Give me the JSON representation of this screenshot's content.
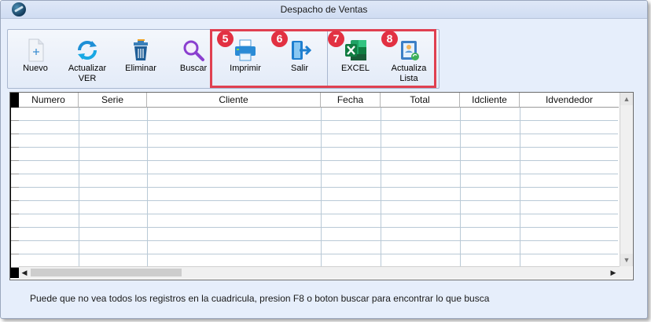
{
  "window": {
    "title": "Despacho de Ventas"
  },
  "toolbar": {
    "buttons": [
      {
        "label_1": "Nuevo",
        "label_2": "",
        "icon": "new-document-icon"
      },
      {
        "label_1": "Actualizar",
        "label_2": "VER",
        "icon": "refresh-icon"
      },
      {
        "label_1": "Eliminar",
        "label_2": "",
        "icon": "trash-icon"
      },
      {
        "label_1": "Buscar",
        "label_2": "",
        "icon": "search-icon"
      },
      {
        "label_1": "Imprimir",
        "label_2": "",
        "icon": "printer-icon",
        "badge": "5"
      },
      {
        "label_1": "Salir",
        "label_2": "",
        "icon": "exit-icon",
        "badge": "6"
      },
      {
        "label_1": "EXCEL",
        "label_2": "",
        "icon": "excel-icon",
        "badge": "7"
      },
      {
        "label_1": "Actualiza",
        "label_2": "Lista",
        "icon": "update-list-icon",
        "badge": "8"
      }
    ],
    "highlight_color": "#e04050"
  },
  "grid": {
    "columns": [
      "Numero",
      "Serie",
      "Cliente",
      "Fecha",
      "Total",
      "Idcliente",
      "Idvendedor"
    ],
    "rows": []
  },
  "status": {
    "message": "Puede que no vea todos los registros en la cuadricula, presion F8 o boton buscar para encontrar lo que busca"
  },
  "colors": {
    "window_bg": "#e6eefb",
    "badge": "#e23142"
  }
}
